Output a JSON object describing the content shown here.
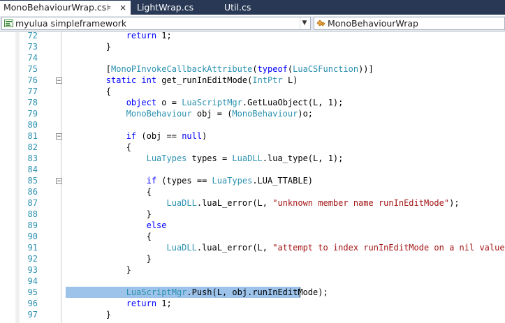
{
  "tabs": [
    {
      "label": "MonoBehaviourWrap.cs",
      "pin_icon": "⊧",
      "close_icon": "×"
    },
    {
      "label": "LightWrap.cs"
    },
    {
      "label": "Util.cs"
    }
  ],
  "nav": {
    "project_label": "myulua simpleframework",
    "type_label": "MonoBehaviourWrap",
    "dropdown_arrow": "▼"
  },
  "editor": {
    "collapse_glyph": "−",
    "lines": [
      {
        "num": "72",
        "tokens": [
          {
            "t": "            ",
            "c": ""
          },
          {
            "t": "return",
            "c": "kw"
          },
          {
            "t": " 1;",
            "c": ""
          }
        ]
      },
      {
        "num": "73",
        "tokens": [
          {
            "t": "        }",
            "c": ""
          }
        ]
      },
      {
        "num": "74",
        "tokens": []
      },
      {
        "num": "75",
        "tokens": [
          {
            "t": "        [",
            "c": ""
          },
          {
            "t": "MonoPInvokeCallbackAttribute",
            "c": "ty"
          },
          {
            "t": "(",
            "c": ""
          },
          {
            "t": "typeof",
            "c": "kw"
          },
          {
            "t": "(",
            "c": ""
          },
          {
            "t": "LuaCSFunction",
            "c": "ty"
          },
          {
            "t": "))]",
            "c": ""
          }
        ]
      },
      {
        "num": "76",
        "tokens": [
          {
            "t": "        ",
            "c": ""
          },
          {
            "t": "static",
            "c": "kw"
          },
          {
            "t": " ",
            "c": ""
          },
          {
            "t": "int",
            "c": "kw"
          },
          {
            "t": " get_runInEditMode(",
            "c": ""
          },
          {
            "t": "IntPtr",
            "c": "ty"
          },
          {
            "t": " L)",
            "c": ""
          }
        ]
      },
      {
        "num": "77",
        "tokens": [
          {
            "t": "        {",
            "c": ""
          }
        ]
      },
      {
        "num": "78",
        "tokens": [
          {
            "t": "            ",
            "c": ""
          },
          {
            "t": "object",
            "c": "kw"
          },
          {
            "t": " o = ",
            "c": ""
          },
          {
            "t": "LuaScriptMgr",
            "c": "ty"
          },
          {
            "t": ".GetLuaObject(L, 1);",
            "c": ""
          }
        ]
      },
      {
        "num": "79",
        "tokens": [
          {
            "t": "            ",
            "c": ""
          },
          {
            "t": "MonoBehaviour",
            "c": "ty"
          },
          {
            "t": " obj = (",
            "c": ""
          },
          {
            "t": "MonoBehaviour",
            "c": "ty"
          },
          {
            "t": ")o;",
            "c": ""
          }
        ]
      },
      {
        "num": "80",
        "tokens": []
      },
      {
        "num": "81",
        "tokens": [
          {
            "t": "            ",
            "c": ""
          },
          {
            "t": "if",
            "c": "kw"
          },
          {
            "t": " (obj == ",
            "c": ""
          },
          {
            "t": "null",
            "c": "kw"
          },
          {
            "t": ")",
            "c": ""
          }
        ]
      },
      {
        "num": "82",
        "tokens": [
          {
            "t": "            {",
            "c": ""
          }
        ]
      },
      {
        "num": "83",
        "tokens": [
          {
            "t": "                ",
            "c": ""
          },
          {
            "t": "LuaTypes",
            "c": "ty"
          },
          {
            "t": " types = ",
            "c": ""
          },
          {
            "t": "LuaDLL",
            "c": "ty"
          },
          {
            "t": ".lua_type(L, 1);",
            "c": ""
          }
        ]
      },
      {
        "num": "84",
        "tokens": []
      },
      {
        "num": "85",
        "tokens": [
          {
            "t": "                ",
            "c": ""
          },
          {
            "t": "if",
            "c": "kw"
          },
          {
            "t": " (types == ",
            "c": ""
          },
          {
            "t": "LuaTypes",
            "c": "ty"
          },
          {
            "t": ".LUA_TTABLE)",
            "c": ""
          }
        ]
      },
      {
        "num": "86",
        "tokens": [
          {
            "t": "                {",
            "c": ""
          }
        ]
      },
      {
        "num": "87",
        "tokens": [
          {
            "t": "                    ",
            "c": ""
          },
          {
            "t": "LuaDLL",
            "c": "ty"
          },
          {
            "t": ".luaL_error(L, ",
            "c": ""
          },
          {
            "t": "\"unknown member name runInEditMode\"",
            "c": "st"
          },
          {
            "t": ");",
            "c": ""
          }
        ]
      },
      {
        "num": "88",
        "tokens": [
          {
            "t": "                }",
            "c": ""
          }
        ]
      },
      {
        "num": "89",
        "tokens": [
          {
            "t": "                ",
            "c": ""
          },
          {
            "t": "else",
            "c": "kw"
          }
        ]
      },
      {
        "num": "90",
        "tokens": [
          {
            "t": "                {",
            "c": ""
          }
        ]
      },
      {
        "num": "91",
        "tokens": [
          {
            "t": "                    ",
            "c": ""
          },
          {
            "t": "LuaDLL",
            "c": "ty"
          },
          {
            "t": ".luaL_error(L, ",
            "c": ""
          },
          {
            "t": "\"attempt to index runInEditMode on a nil value\"",
            "c": "st"
          },
          {
            "t": ");",
            "c": ""
          }
        ]
      },
      {
        "num": "92",
        "tokens": [
          {
            "t": "                }",
            "c": ""
          }
        ]
      },
      {
        "num": "93",
        "tokens": [
          {
            "t": "            }",
            "c": ""
          }
        ]
      },
      {
        "num": "94",
        "tokens": []
      },
      {
        "num": "95",
        "tokens": [
          {
            "t": "            ",
            "c": ""
          },
          {
            "t": "LuaScriptMgr",
            "c": "ty"
          },
          {
            "t": ".Push(L, obj.runInEditMode);",
            "c": ""
          }
        ],
        "selected": true
      },
      {
        "num": "96",
        "tokens": [
          {
            "t": "            ",
            "c": ""
          },
          {
            "t": "return",
            "c": "kw"
          },
          {
            "t": " 1;",
            "c": ""
          }
        ]
      },
      {
        "num": "97",
        "tokens": [
          {
            "t": "        }",
            "c": ""
          }
        ]
      }
    ],
    "collapse_lines": [
      "76",
      "81",
      "85"
    ]
  },
  "colors": {
    "tab_strip": "#293955",
    "line_number": "#2b91af",
    "keyword": "#0000ff",
    "type": "#2b91af",
    "string": "#a31515",
    "selection": "#9dc3ea"
  }
}
